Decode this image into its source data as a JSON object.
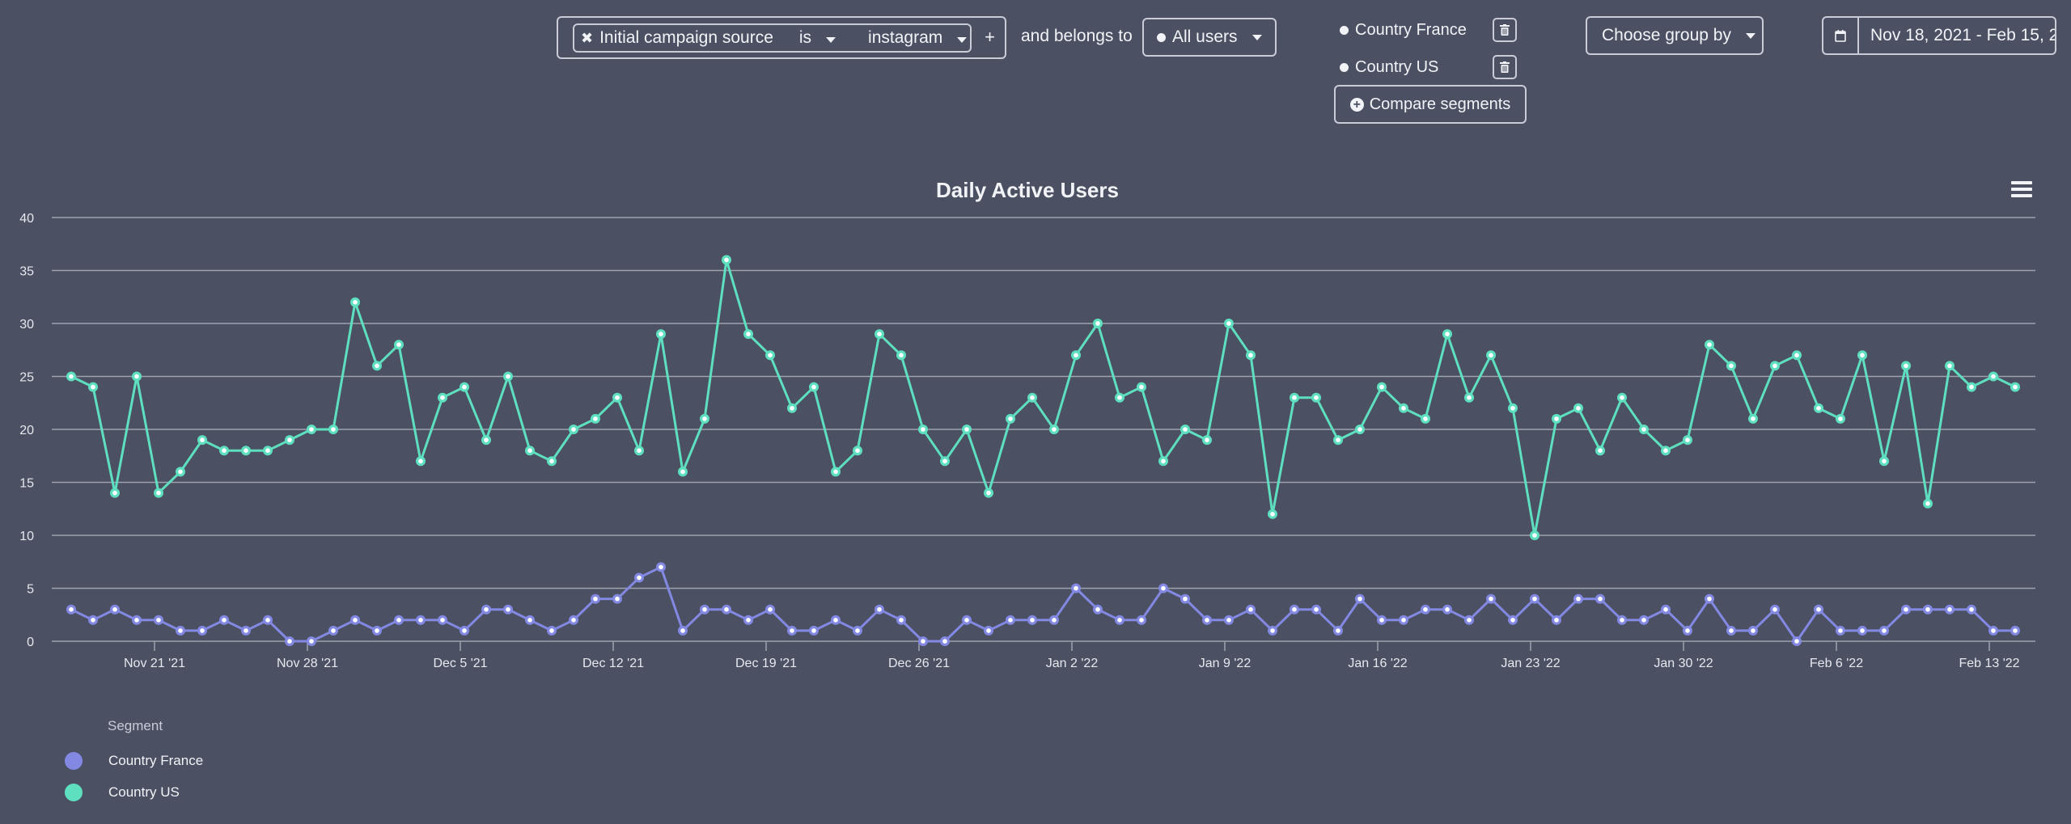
{
  "filters": {
    "remove_icon": "close-icon",
    "property": "Initial campaign source",
    "operator": "is",
    "value": "instagram",
    "add_label": "+",
    "belongs_to_label": "and belongs to",
    "audience": "All users"
  },
  "segments": {
    "items": [
      {
        "label": "Country France",
        "delete_icon": "trash-icon"
      },
      {
        "label": "Country US",
        "delete_icon": "trash-icon"
      }
    ],
    "compare_label": "Compare segments"
  },
  "group_by": {
    "label": "Choose group by"
  },
  "date_range": {
    "icon": "calendar-icon",
    "value": "Nov 18, 2021 - Feb 15, 2"
  },
  "legend": {
    "title": "Segment",
    "items": [
      {
        "label": "Country France",
        "color": "#8389e2"
      },
      {
        "label": "Country US",
        "color": "#5ee0c0"
      }
    ]
  },
  "chart_data": {
    "type": "line",
    "title": "Daily Active Users",
    "xlabel": "",
    "ylabel": "",
    "ylim": [
      0,
      40
    ],
    "yticks": [
      0,
      5,
      10,
      15,
      20,
      25,
      30,
      35,
      40
    ],
    "grid": true,
    "legend_position": "bottom-left",
    "x_start": "2021-11-17",
    "x_interval": "1 day",
    "x_count": 90,
    "xticks": [
      {
        "index": 4,
        "label": "Nov 21 '21"
      },
      {
        "index": 11,
        "label": "Nov 28 '21"
      },
      {
        "index": 18,
        "label": "Dec 5 '21"
      },
      {
        "index": 25,
        "label": "Dec 12 '21"
      },
      {
        "index": 32,
        "label": "Dec 19 '21"
      },
      {
        "index": 39,
        "label": "Dec 26 '21"
      },
      {
        "index": 46,
        "label": "Jan 2 '22"
      },
      {
        "index": 53,
        "label": "Jan 9 '22"
      },
      {
        "index": 60,
        "label": "Jan 16 '22"
      },
      {
        "index": 67,
        "label": "Jan 23 '22"
      },
      {
        "index": 74,
        "label": "Jan 30 '22"
      },
      {
        "index": 81,
        "label": "Feb 6 '22"
      },
      {
        "index": 88,
        "label": "Feb 13 '22"
      }
    ],
    "series": [
      {
        "name": "Country US",
        "color": "#5ee0c0",
        "values": [
          25,
          24,
          14,
          25,
          14,
          16,
          19,
          18,
          18,
          18,
          19,
          20,
          20,
          32,
          26,
          28,
          17,
          23,
          24,
          19,
          25,
          18,
          17,
          20,
          21,
          23,
          18,
          29,
          16,
          21,
          36,
          29,
          27,
          22,
          24,
          16,
          18,
          29,
          27,
          20,
          17,
          20,
          14,
          21,
          23,
          20,
          27,
          30,
          23,
          24,
          17,
          20,
          19,
          30,
          27,
          12,
          23,
          23,
          19,
          20,
          24,
          22,
          21,
          29,
          23,
          27,
          22,
          10,
          21,
          22,
          18,
          23,
          20,
          18,
          19,
          28,
          26,
          21,
          26,
          27,
          22,
          21,
          27,
          17,
          26,
          13,
          26,
          24,
          25,
          24
        ]
      },
      {
        "name": "Country France",
        "color": "#8389e2",
        "values": [
          3,
          2,
          3,
          2,
          2,
          1,
          1,
          2,
          1,
          2,
          0,
          0,
          1,
          2,
          1,
          2,
          2,
          2,
          1,
          3,
          3,
          2,
          1,
          2,
          4,
          4,
          6,
          7,
          1,
          3,
          3,
          2,
          3,
          1,
          1,
          2,
          1,
          3,
          2,
          0,
          0,
          2,
          1,
          2,
          2,
          2,
          5,
          3,
          2,
          2,
          5,
          4,
          2,
          2,
          3,
          1,
          3,
          3,
          1,
          4,
          2,
          2,
          3,
          3,
          2,
          4,
          2,
          4,
          2,
          4,
          4,
          2,
          2,
          3,
          1,
          4,
          1,
          1,
          3,
          0,
          3,
          1,
          1,
          1,
          3,
          3,
          3,
          3,
          1,
          1
        ]
      }
    ]
  }
}
